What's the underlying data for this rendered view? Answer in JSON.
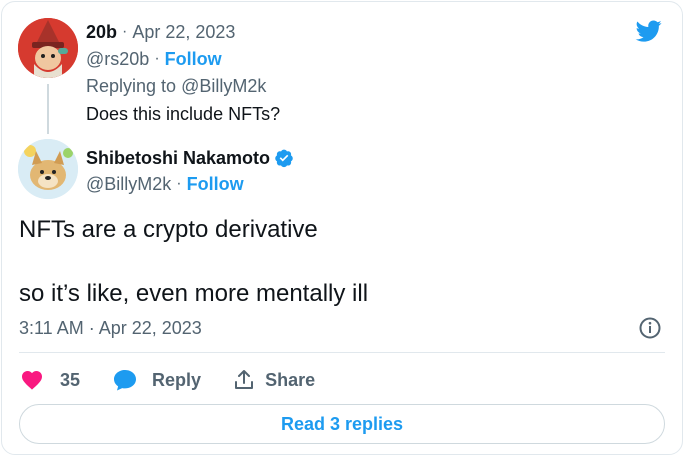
{
  "reply_tweet": {
    "author_name": "20b",
    "date": "Apr 22, 2023",
    "handle": "@rs20b",
    "follow_label": "Follow",
    "replying_prefix": "Replying to",
    "replying_handle": "@BillyM2k",
    "text": "Does this include NFTs?"
  },
  "main_tweet": {
    "author_name": "Shibetoshi Nakamoto",
    "handle": "@BillyM2k",
    "follow_label": "Follow",
    "text_line1": "NFTs are a crypto derivative",
    "text_line2": "so it’s like, even more mentally ill",
    "timestamp": "3:11 AM · Apr 22, 2023"
  },
  "actions": {
    "like_count": "35",
    "reply_label": "Reply",
    "share_label": "Share"
  },
  "read_replies_label": "Read 3 replies",
  "separator": "·",
  "colors": {
    "twitter_blue": "#1d9bf0",
    "like_pink": "#f91880",
    "muted_text": "#536471"
  },
  "icons": [
    "twitter-bird-icon",
    "verified-badge-icon",
    "info-icon",
    "heart-icon",
    "reply-bubble-icon",
    "share-icon"
  ]
}
